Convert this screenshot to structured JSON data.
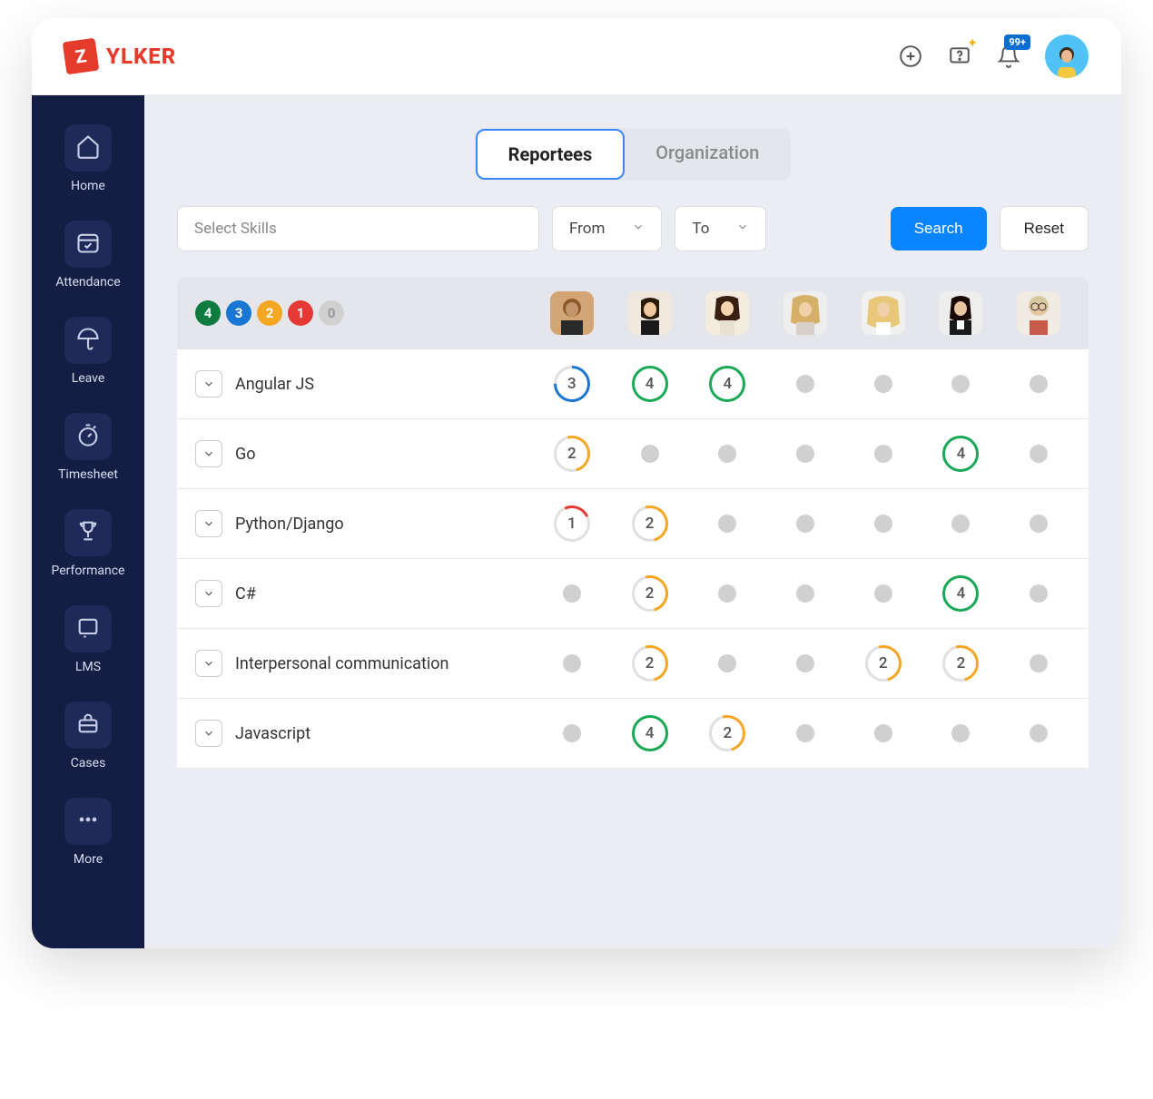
{
  "brand": {
    "badge_letter": "Z",
    "name": "YLKER"
  },
  "header": {
    "notification_badge": "99+"
  },
  "sidebar": {
    "items": [
      {
        "label": "Home",
        "icon": "home"
      },
      {
        "label": "Attendance",
        "icon": "calendar-check"
      },
      {
        "label": "Leave",
        "icon": "umbrella"
      },
      {
        "label": "Timesheet",
        "icon": "stopwatch"
      },
      {
        "label": "Performance",
        "icon": "trophy"
      },
      {
        "label": "LMS",
        "icon": "book"
      },
      {
        "label": "Cases",
        "icon": "briefcase"
      },
      {
        "label": "More",
        "icon": "dots"
      }
    ]
  },
  "tabs": {
    "active": "Reportees",
    "items": [
      "Reportees",
      "Organization"
    ]
  },
  "filters": {
    "skills_placeholder": "Select Skills",
    "from_label": "From",
    "to_label": "To",
    "search_label": "Search",
    "reset_label": "Reset"
  },
  "legend": [
    "4",
    "3",
    "2",
    "1",
    "0"
  ],
  "users": [
    {
      "id": "u1"
    },
    {
      "id": "u2"
    },
    {
      "id": "u3"
    },
    {
      "id": "u4"
    },
    {
      "id": "u5"
    },
    {
      "id": "u6"
    },
    {
      "id": "u7"
    }
  ],
  "skills": [
    {
      "name": "Angular JS",
      "scores": [
        3,
        4,
        4,
        null,
        null,
        null,
        null
      ]
    },
    {
      "name": "Go",
      "scores": [
        2,
        null,
        null,
        null,
        null,
        4,
        null
      ]
    },
    {
      "name": "Python/Django",
      "scores": [
        1,
        2,
        null,
        null,
        null,
        null,
        null
      ]
    },
    {
      "name": "C#",
      "scores": [
        null,
        2,
        null,
        null,
        null,
        4,
        null
      ]
    },
    {
      "name": "Interpersonal communication",
      "scores": [
        null,
        2,
        null,
        null,
        2,
        2,
        null
      ]
    },
    {
      "name": "Javascript",
      "scores": [
        null,
        4,
        2,
        null,
        null,
        null,
        null
      ]
    }
  ],
  "colors": {
    "accent": "#0a84ff",
    "sidebar_bg": "#141e45",
    "level4": "#0f7b3e",
    "level3": "#1976d2",
    "level2": "#f5a623",
    "level1": "#e53935"
  }
}
